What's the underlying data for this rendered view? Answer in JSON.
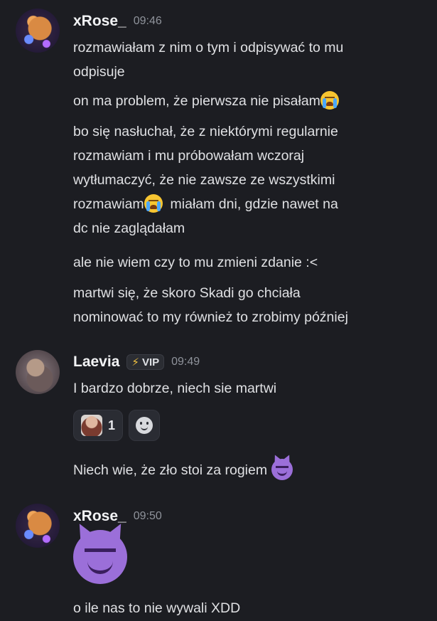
{
  "messages": [
    {
      "username": "xRose_",
      "time": "09:46",
      "lines": [
        "rozmawiałam z nim o tym i odpisywać to mu",
        "odpisuje",
        "on ma problem, że pierwsza nie pisałam",
        "bo się nasłuchał, że z niektórymi regularnie",
        "rozmawiam i mu próbowałam wczoraj",
        "wytłumaczyć, że nie zawsze ze wszystkimi",
        "rozmawiam",
        "miałam dni, gdzie nawet na",
        "dc nie zaglądałam",
        "ale nie wiem czy to mu zmieni zdanie :<",
        "martwi się, że skoro Skadi go chciała",
        "nominować to my również to zrobimy później"
      ]
    },
    {
      "username": "Laevia",
      "badge": "VIP",
      "time": "09:49",
      "lines": [
        "I bardzo dobrze, niech sie martwi",
        "Niech wie, że zło stoi za rogiem"
      ],
      "reaction_count": "1"
    },
    {
      "username": "xRose_",
      "time": "09:50",
      "lines": [
        "o ile nas to nie wywali XDD"
      ]
    }
  ],
  "icons": {
    "crying": "loudly-crying-face-emoji",
    "devil": "smiling-face-with-horns-emoji",
    "add_reaction": "add-reaction-icon",
    "vip": "lightning-bolt-icon"
  },
  "colors": {
    "background": "#1c1d22",
    "text": "#dfe0e3",
    "timestamp": "#8f939b",
    "devil": "#9b6fd9",
    "vip_bolt": "#f5c542"
  }
}
